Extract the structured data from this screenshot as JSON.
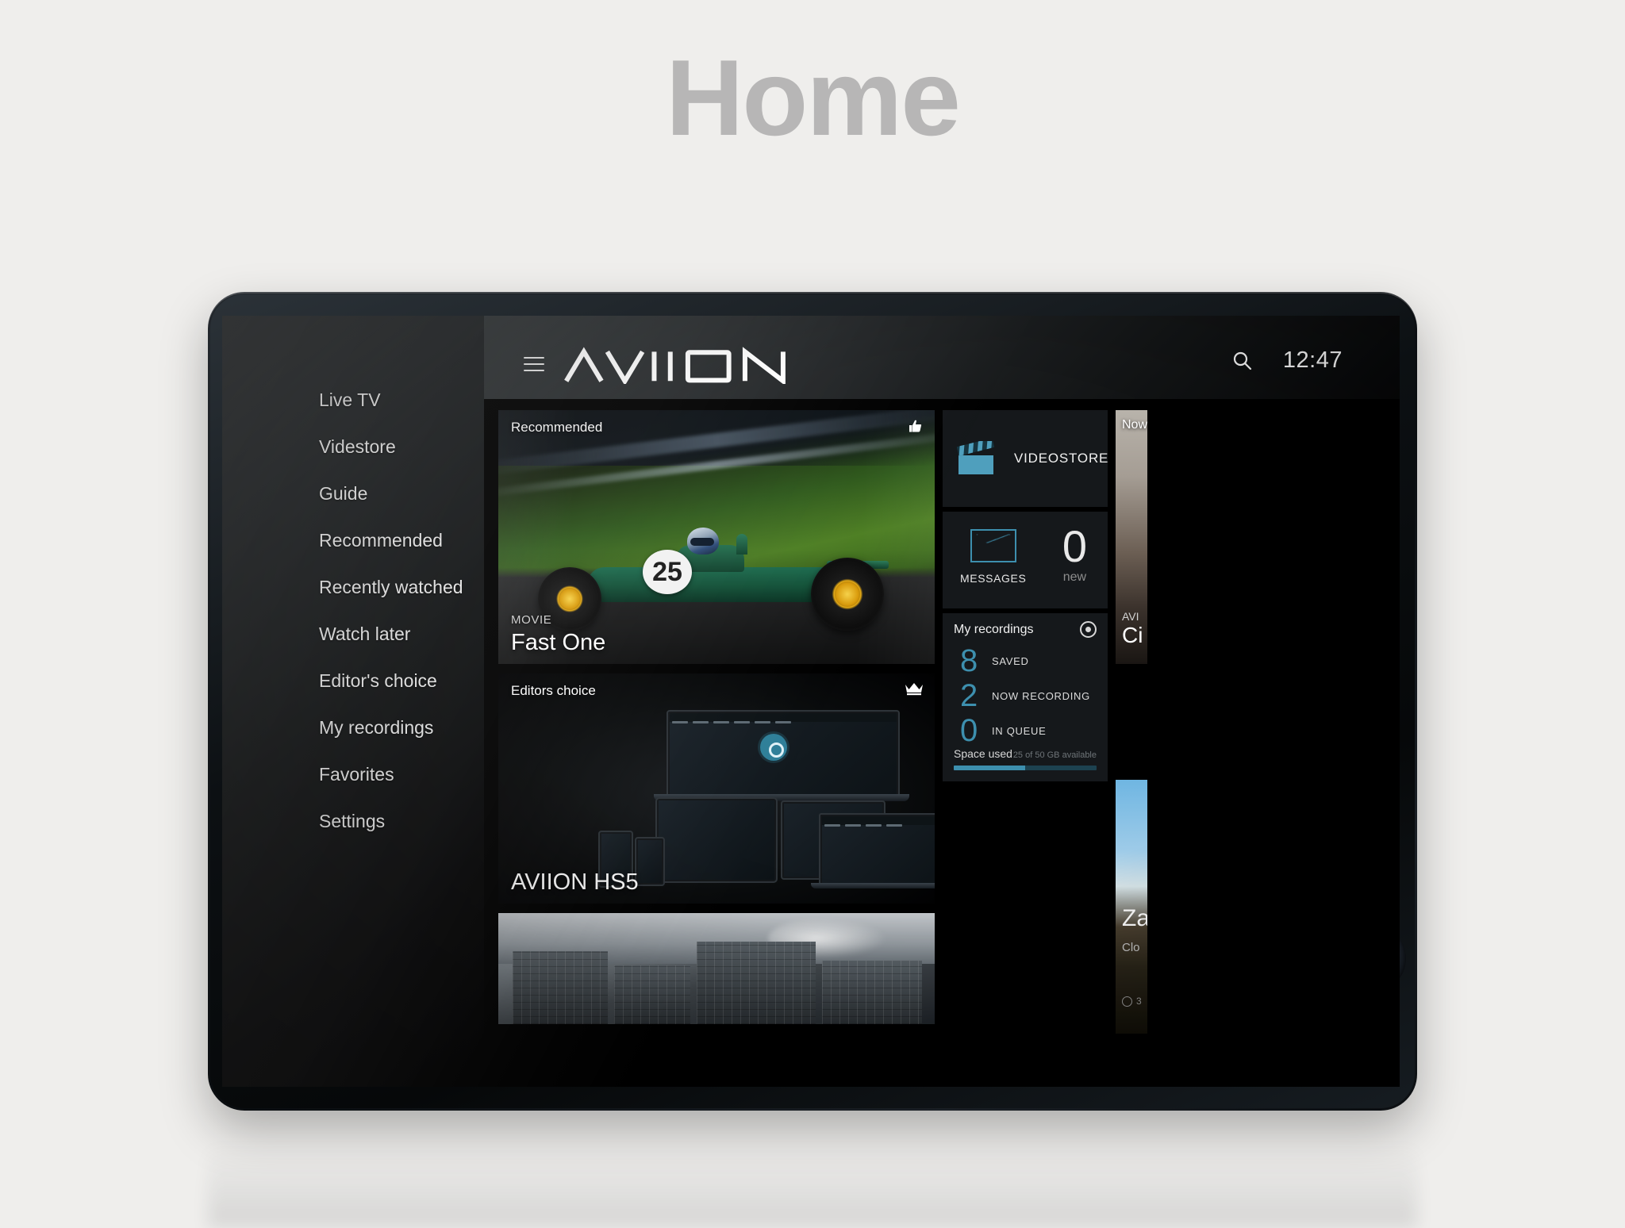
{
  "page": {
    "title": "Home",
    "title_color": "#b7b6b6",
    "background_color": "#efeeec"
  },
  "accent_color": "#3d8fae",
  "app": {
    "logo_text": "AVIION",
    "menu_icon": "hamburger-icon",
    "search_icon": "search-icon",
    "clock": "12:47"
  },
  "sidebar": {
    "items": [
      {
        "label": "Live TV"
      },
      {
        "label": "Videstore"
      },
      {
        "label": "Guide"
      },
      {
        "label": "Recommended"
      },
      {
        "label": "Recently watched"
      },
      {
        "label": "Watch later"
      },
      {
        "label": "Editor's choice"
      },
      {
        "label": "My recordings"
      },
      {
        "label": "Favorites"
      },
      {
        "label": "Settings"
      }
    ]
  },
  "main": {
    "hero": {
      "label": "Recommended",
      "corner_icon": "thumbs-up-icon",
      "kicker": "MOVIE",
      "title": "Fast One",
      "car_number": "25"
    },
    "editors": {
      "label": "Editors choice",
      "corner_icon": "crown-icon",
      "title": "AVIION HS5"
    },
    "bottom_card": {
      "label": ""
    }
  },
  "rail": {
    "videostore": {
      "label": "VIDEOSTORE",
      "icon": "clapperboard-icon"
    },
    "messages": {
      "label": "MESSAGES",
      "icon": "envelope-icon",
      "count": "0",
      "count_label": "new"
    },
    "recordings": {
      "title": "My recordings",
      "icon": "record-dot-icon",
      "stats": [
        {
          "value": "8",
          "label": "SAVED"
        },
        {
          "value": "2",
          "label": "NOW RECORDING"
        },
        {
          "value": "0",
          "label": "IN QUEUE"
        }
      ],
      "space_label": "Space used",
      "space_available": "25 of 50 GB available",
      "space_percent": 50
    }
  },
  "cut_cards": {
    "top": {
      "label": "Now",
      "kicker": "AVI",
      "title": "Ci"
    },
    "bottom": {
      "title": "Za",
      "subtitle": "Clo",
      "meta": "3"
    }
  }
}
